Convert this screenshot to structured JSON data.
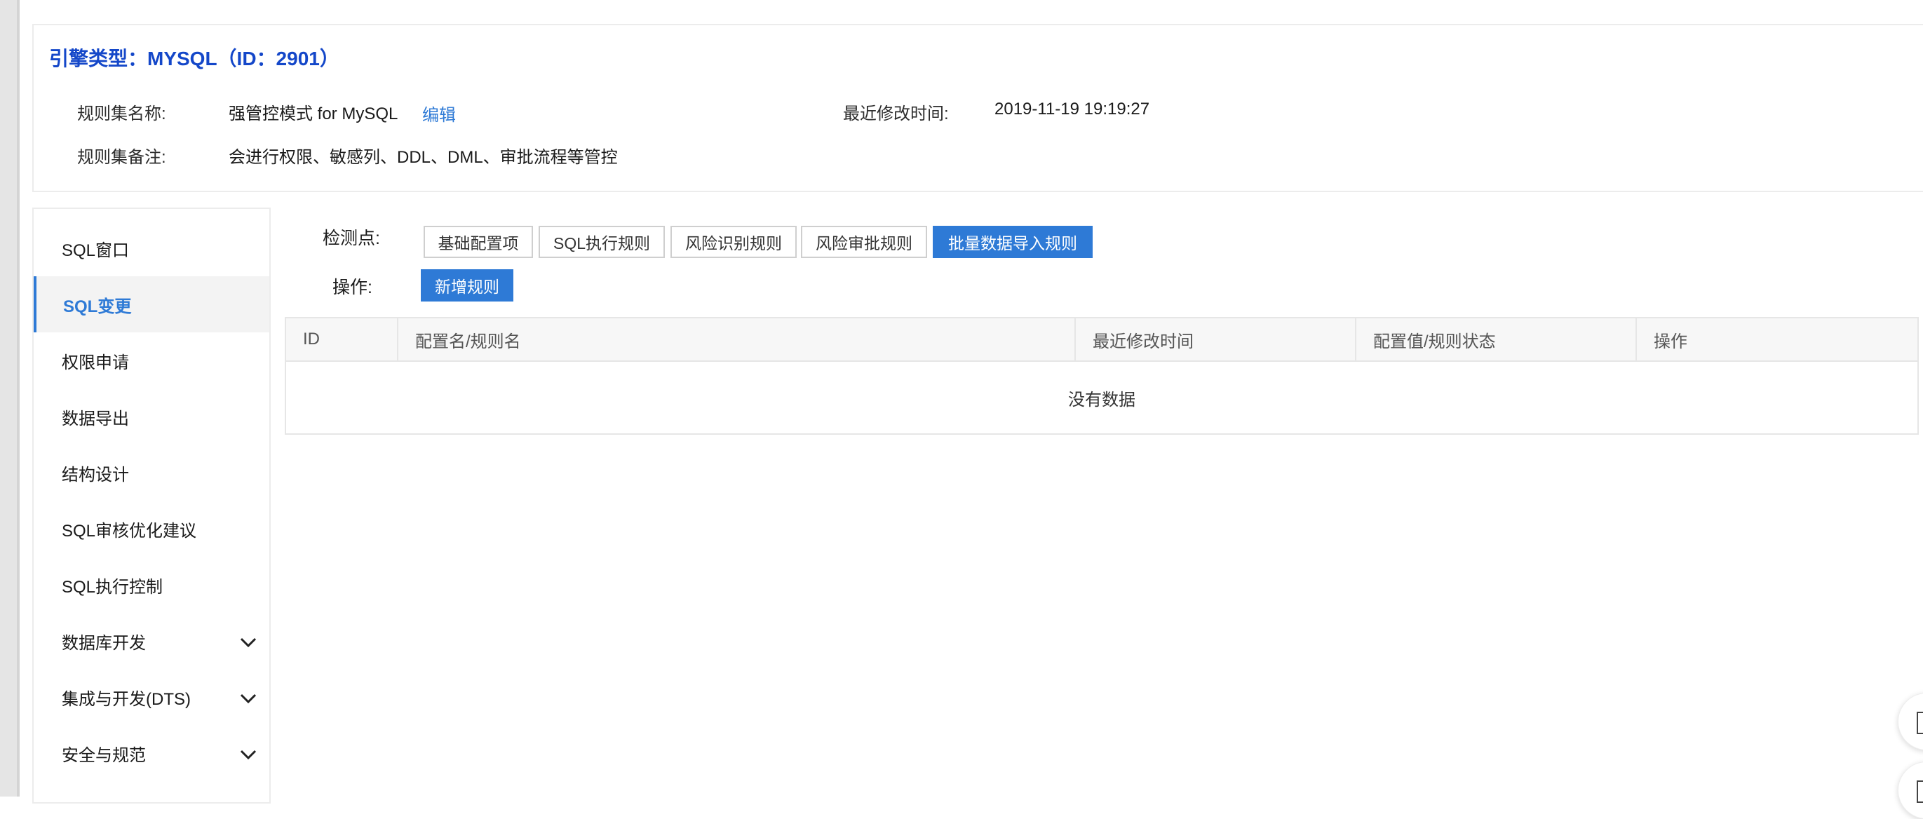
{
  "header": {
    "title": "引擎类型：MYSQL（ID：2901）",
    "ruleset_name_label": "规则集名称:",
    "ruleset_name": "强管控模式 for MySQL",
    "edit_label": "编辑",
    "modified_label": "最近修改时间:",
    "modified_value": "2019-11-19 19:19:27",
    "remark_label": "规则集备注:",
    "remark_value": "会进行权限、敏感列、DDL、DML、审批流程等管控"
  },
  "sidebar": {
    "items": [
      {
        "label": "SQL窗口",
        "active": false,
        "expandable": false
      },
      {
        "label": "SQL变更",
        "active": true,
        "expandable": false
      },
      {
        "label": "权限申请",
        "active": false,
        "expandable": false
      },
      {
        "label": "数据导出",
        "active": false,
        "expandable": false
      },
      {
        "label": "结构设计",
        "active": false,
        "expandable": false
      },
      {
        "label": "SQL审核优化建议",
        "active": false,
        "expandable": false
      },
      {
        "label": "SQL执行控制",
        "active": false,
        "expandable": false
      },
      {
        "label": "数据库开发",
        "active": false,
        "expandable": true
      },
      {
        "label": "集成与开发(DTS)",
        "active": false,
        "expandable": true
      },
      {
        "label": "安全与规范",
        "active": false,
        "expandable": true
      }
    ]
  },
  "main": {
    "checkpoint_label": "检测点:",
    "operation_label": "操作:",
    "tabs": [
      {
        "label": "基础配置项",
        "active": false
      },
      {
        "label": "SQL执行规则",
        "active": false
      },
      {
        "label": "风险识别规则",
        "active": false
      },
      {
        "label": "风险审批规则",
        "active": false
      },
      {
        "label": "批量数据导入规则",
        "active": true
      }
    ],
    "add_rule_label": "新增规则",
    "table": {
      "columns": [
        "ID",
        "配置名/规则名",
        "最近修改时间",
        "配置值/规则状态",
        "操作"
      ],
      "empty_text": "没有数据"
    }
  },
  "colors": {
    "accent": "#2e7ad6",
    "title": "#1447c9"
  }
}
